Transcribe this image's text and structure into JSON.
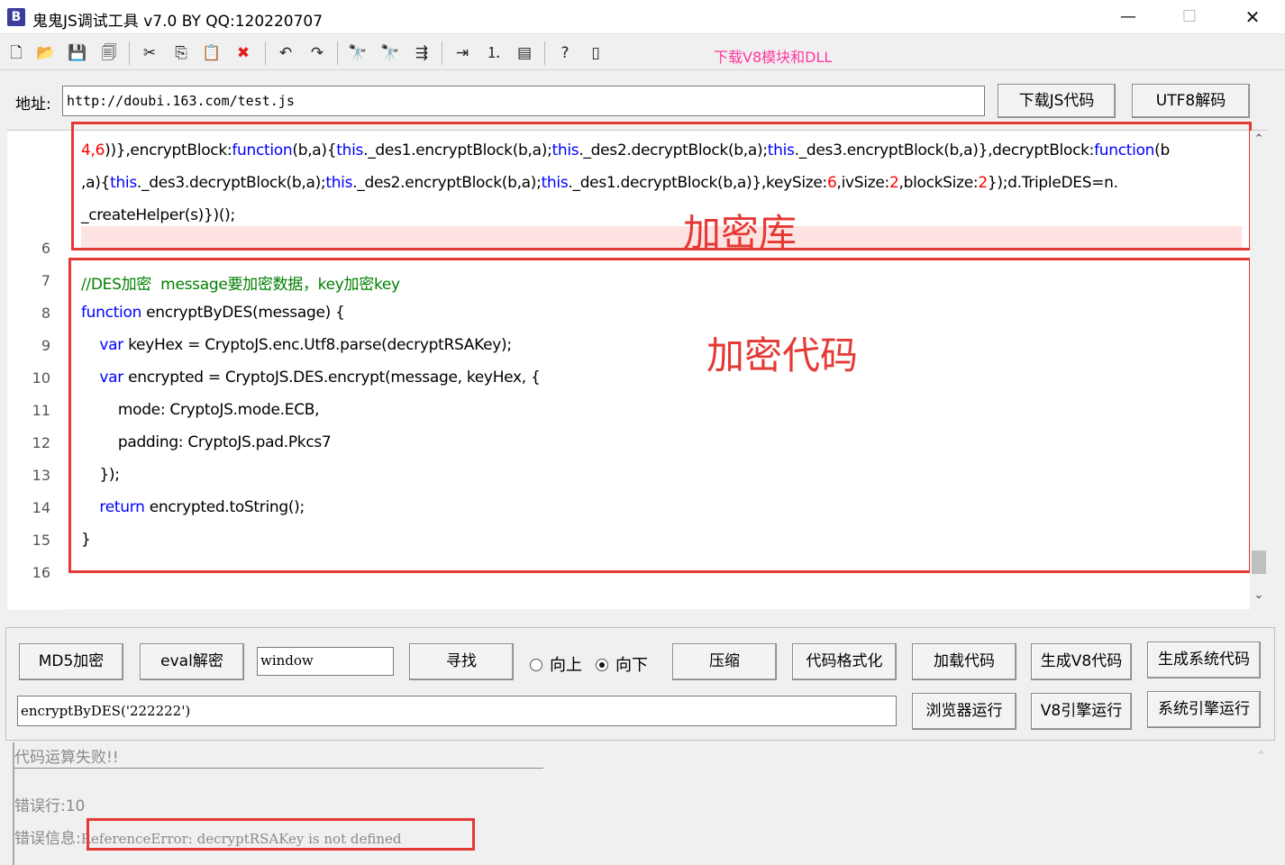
{
  "window": {
    "icon_letter": "B",
    "title": "鬼鬼JS调试工具 v7.0 BY QQ:120220707",
    "min_symbol": "—",
    "max_symbol": "☐",
    "close_symbol": "✕"
  },
  "toolbar": {
    "icons": [
      "new-file-icon",
      "open-folder-icon",
      "save-icon",
      "save-all-icon",
      "cut-icon",
      "copy-icon",
      "paste-icon",
      "delete-icon",
      "undo-icon",
      "redo-icon",
      "find-icon",
      "find-next-icon",
      "replace-icon",
      "indent-icon",
      "numbered-list-icon",
      "window-icon",
      "help-icon",
      "panel-icon"
    ],
    "glyphs": [
      "🗋",
      "📂",
      "💾",
      "🗐",
      "✂",
      "⎘",
      "📋",
      "✖",
      "↶",
      "↷",
      "🔭",
      "🔭",
      "⇶",
      "⇥",
      "⒈",
      "▤",
      "?",
      "▯"
    ],
    "download_link": "下载V8模块和DLL",
    "link_color": "#ff3aa0"
  },
  "address": {
    "label": "地址:",
    "value": "http://doubi.163.com/test.js",
    "download_button": "下载JS代码",
    "utf8_button": "UTF8解码"
  },
  "editor": {
    "line_numbers": [
      "6",
      "7",
      "8",
      "9",
      "10",
      "11",
      "12",
      "13",
      "14",
      "15",
      "16"
    ],
    "wrapped_lines": [
      [
        {
          "t": "4,6",
          "c": "num"
        },
        {
          "t": "))}"
        },
        {
          "t": ",encryptBlock:"
        },
        {
          "t": "function",
          "c": "kw"
        },
        {
          "t": "(b,a){"
        },
        {
          "t": "this",
          "c": "kw"
        },
        {
          "t": "._des1.encryptBlock(b,a);"
        },
        {
          "t": "this",
          "c": "kw"
        },
        {
          "t": "._des2.decryptBlock(b,a);"
        },
        {
          "t": "this",
          "c": "kw"
        },
        {
          "t": "._des3.encryptBlock(b,a)},decryptBlock:"
        },
        {
          "t": "function",
          "c": "kw"
        },
        {
          "t": "(b"
        }
      ],
      [
        {
          "t": ",a){"
        },
        {
          "t": "this",
          "c": "kw"
        },
        {
          "t": "._des3.decryptBlock(b,a);"
        },
        {
          "t": "this",
          "c": "kw"
        },
        {
          "t": "._des2.encryptBlock(b,a);"
        },
        {
          "t": "this",
          "c": "kw"
        },
        {
          "t": "._des1.decryptBlock(b,a)},keySize:"
        },
        {
          "t": "6",
          "c": "num"
        },
        {
          "t": ",ivSize:"
        },
        {
          "t": "2",
          "c": "num"
        },
        {
          "t": ",blockSize:"
        },
        {
          "t": "2",
          "c": "num"
        },
        {
          "t": "});d.TripleDES=n."
        }
      ],
      [
        {
          "t": "_createHelper(s)})();"
        }
      ]
    ],
    "code_lines": [
      [
        {
          "t": "//DES加密  message要加密数据，key加密key",
          "c": "cm"
        }
      ],
      [
        {
          "t": "function",
          "c": "kw"
        },
        {
          "t": " encryptByDES(message) {"
        }
      ],
      [
        {
          "t": "    "
        },
        {
          "t": "var",
          "c": "kw"
        },
        {
          "t": " keyHex = CryptoJS.enc.Utf8.parse(decryptRSAKey);"
        }
      ],
      [
        {
          "t": "    "
        },
        {
          "t": "var",
          "c": "kw"
        },
        {
          "t": " encrypted = CryptoJS.DES.encrypt(message, keyHex, {"
        }
      ],
      [
        {
          "t": "        mode: CryptoJS.mode.ECB,"
        }
      ],
      [
        {
          "t": "        padding: CryptoJS.pad.Pkcs7"
        }
      ],
      [
        {
          "t": "    });"
        }
      ],
      [
        {
          "t": "    "
        },
        {
          "t": "return",
          "c": "kw"
        },
        {
          "t": " encrypted.toString();"
        }
      ],
      [
        {
          "t": "}"
        }
      ]
    ],
    "annotation_library": "加密库",
    "annotation_code": "加密代码",
    "scroll_up": "⌃",
    "scroll_down": "⌄"
  },
  "controls": {
    "md5_button": "MD5加密",
    "eval_button": "eval解密",
    "find_value": "window",
    "find_button": "寻找",
    "radio_up": "向上",
    "radio_down": "向下",
    "radio_selected": "向下",
    "compress_button": "压缩",
    "format_button": "代码格式化",
    "load_button": "加载代码",
    "gen_v8_button": "生成V8代码",
    "gen_system_button": "生成系统代码",
    "call_value": "encryptByDES('222222')",
    "browser_run_button": "浏览器运行",
    "v8_run_button": "V8引擎运行",
    "system_run_button": "系统引擎运行"
  },
  "output": {
    "status": "代码运算失败!!",
    "error_line_label": "错误行:",
    "error_line": "10",
    "error_info_label": "错误信息:",
    "error_message": "ReferenceError: decryptRSAKey is not defined"
  }
}
